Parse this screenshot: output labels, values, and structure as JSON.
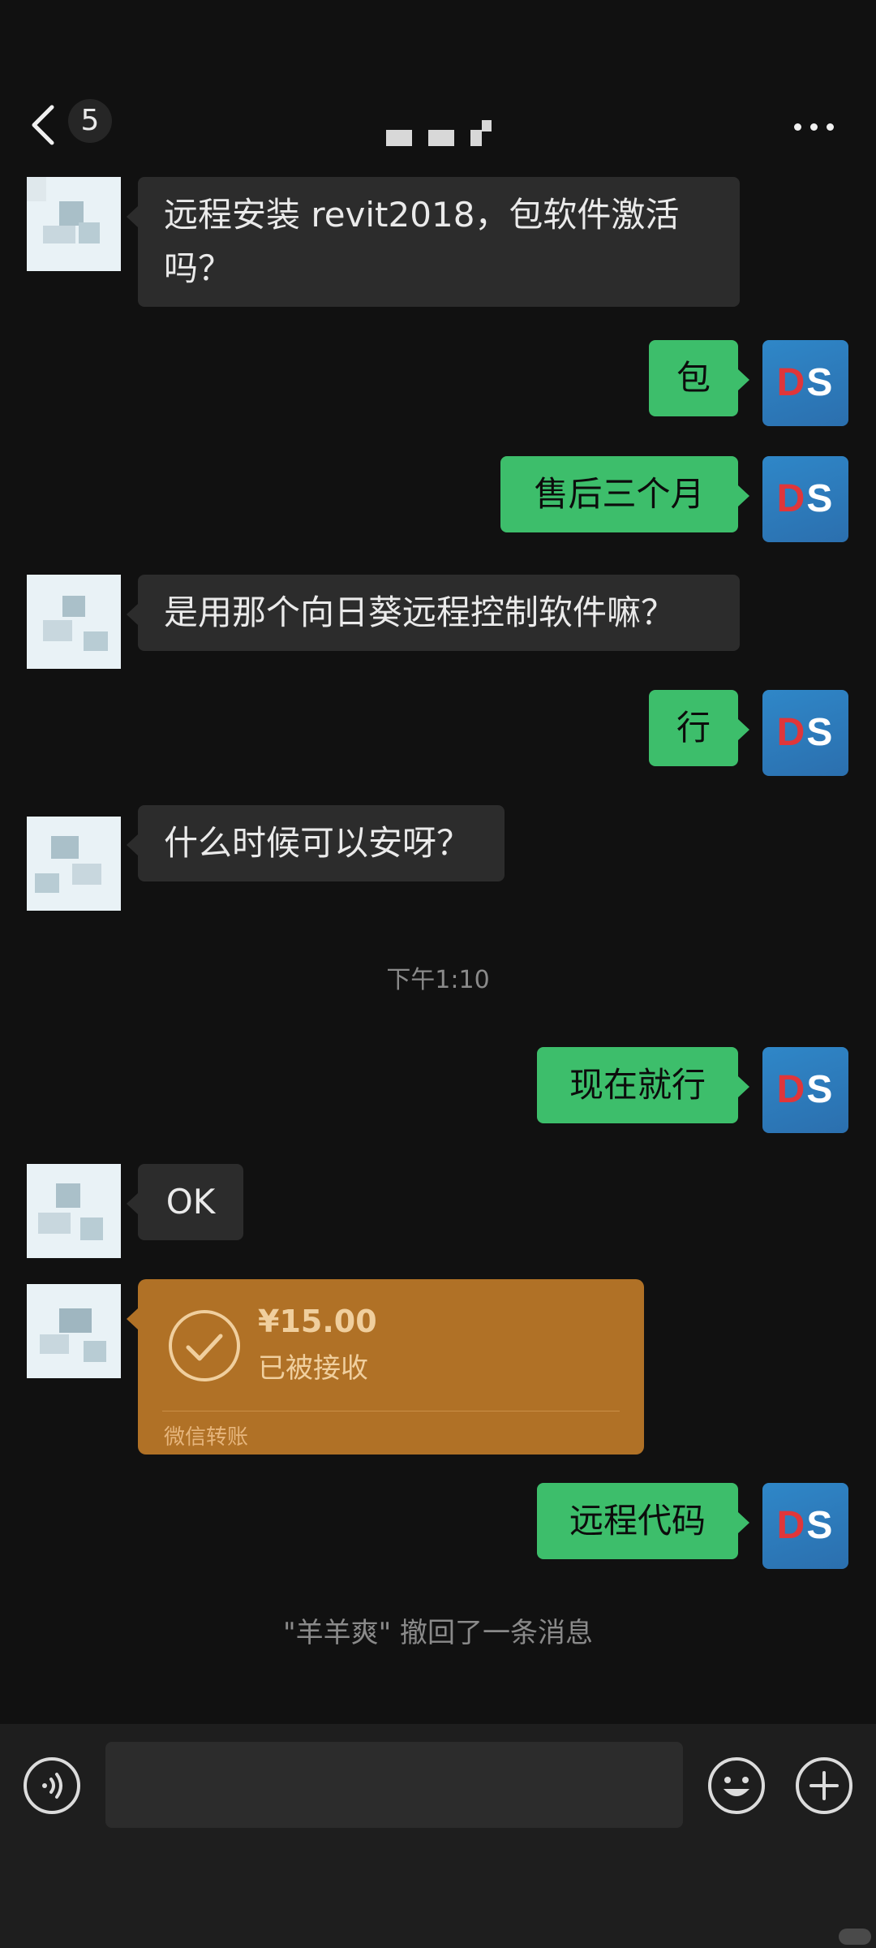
{
  "header": {
    "back_icon": "chevron-left-icon",
    "unread_count": "5",
    "more_icon": "more-dots-icon"
  },
  "messages": [
    {
      "from": "other",
      "text": "远程安装 revit2018，包软件激活吗？"
    },
    {
      "from": "self",
      "text": "包"
    },
    {
      "from": "self",
      "text": "售后三个月"
    },
    {
      "from": "other",
      "text": "是用那个向日葵远程控制软件嘛？"
    },
    {
      "from": "self",
      "text": "行"
    },
    {
      "from": "other",
      "text": "什么时候可以安呀？"
    },
    {
      "type": "timestamp",
      "text": "下午1:10"
    },
    {
      "from": "self",
      "text": "现在就行"
    },
    {
      "from": "other",
      "text": "OK"
    },
    {
      "from": "other",
      "type": "transfer",
      "amount": "¥15.00",
      "status": "已被接收",
      "footer": "微信转账"
    },
    {
      "from": "self",
      "text": "远程代码"
    },
    {
      "type": "system",
      "text": "\"羊羊爽\" 撤回了一条消息"
    }
  ],
  "self_avatar": {
    "d": "D",
    "s": "S"
  },
  "input_bar": {
    "voice_icon": "voice-icon",
    "emoji_icon": "emoji-icon",
    "plus_icon": "plus-icon"
  },
  "colors": {
    "background": "#111111",
    "incoming_bubble": "#2c2c2c",
    "outgoing_bubble": "#3dbe6b",
    "transfer_card": "#b07126"
  }
}
